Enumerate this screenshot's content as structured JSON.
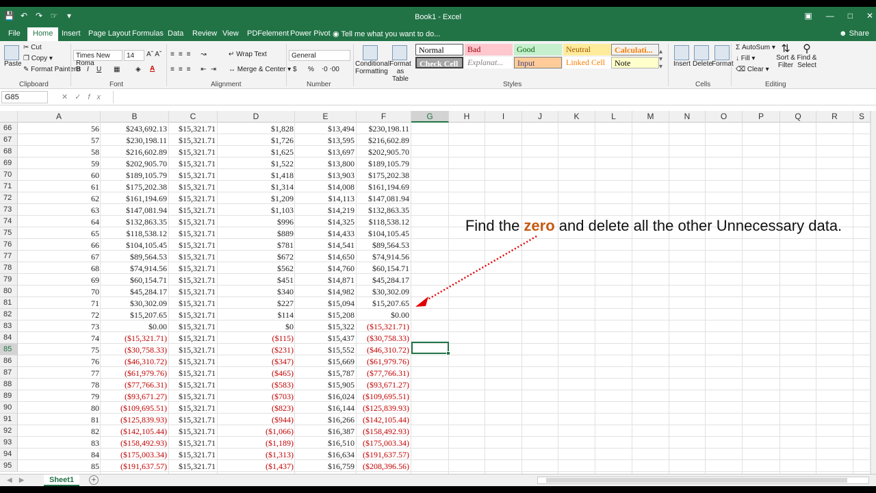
{
  "window": {
    "title": "Book1 - Excel",
    "qat": [
      "save",
      "undo",
      "redo",
      "touch",
      "customize"
    ]
  },
  "tabs": [
    "File",
    "Home",
    "Insert",
    "Page Layout",
    "Formulas",
    "Data",
    "Review",
    "View",
    "PDFelement",
    "Power Pivot"
  ],
  "tell_me": "Tell me what you want to do...",
  "share": "Share",
  "ribbon": {
    "clipboard": {
      "paste": "Paste",
      "cut": "Cut",
      "copy": "Copy",
      "format_painter": "Format Painter",
      "label": "Clipboard"
    },
    "font": {
      "name": "Times New Roma",
      "size": "14",
      "label": "Font",
      "bold": "B",
      "italic": "I",
      "underline": "U"
    },
    "alignment": {
      "wrap": "Wrap Text",
      "merge": "Merge & Center",
      "label": "Alignment"
    },
    "number": {
      "format": "General",
      "currency": "$",
      "percent": "%",
      "label": "Number"
    },
    "styles": {
      "conditional": "Conditional Formatting",
      "format_table": "Format as Table",
      "cells": [
        {
          "text": "Normal",
          "bg": "#ffffff",
          "fg": "#000000"
        },
        {
          "text": "Bad",
          "bg": "#ffc7ce",
          "fg": "#9c0006"
        },
        {
          "text": "Good",
          "bg": "#c6efce",
          "fg": "#006100"
        },
        {
          "text": "Neutral",
          "bg": "#ffeb9c",
          "fg": "#9c5700"
        },
        {
          "text": "Calculati...",
          "bg": "#f2f2f2",
          "fg": "#fa7d00"
        },
        {
          "text": "Check Cell",
          "bg": "#a5a5a5",
          "fg": "#ffffff"
        },
        {
          "text": "Explanat...",
          "bg": "#ffffff",
          "fg": "#7f7f7f"
        },
        {
          "text": "Input",
          "bg": "#ffcc99",
          "fg": "#3f3f76"
        },
        {
          "text": "Linked Cell",
          "bg": "#ffffff",
          "fg": "#fa7d00"
        },
        {
          "text": "Note",
          "bg": "#ffffcc",
          "fg": "#000000"
        }
      ],
      "label": "Styles"
    },
    "cells": {
      "insert": "Insert",
      "delete": "Delete",
      "format": "Format",
      "label": "Cells"
    },
    "editing": {
      "autosum": "AutoSum",
      "fill": "Fill",
      "clear": "Clear",
      "sort": "Sort & Filter",
      "find": "Find & Select",
      "label": "Editing"
    }
  },
  "namebox": "G85",
  "columns": [
    "A",
    "B",
    "C",
    "D",
    "E",
    "F",
    "G",
    "H",
    "I",
    "J",
    "K",
    "L",
    "M",
    "N",
    "O",
    "P",
    "Q",
    "R",
    "S"
  ],
  "selected_column": "G",
  "selected_row": "85",
  "rows": [
    [
      "66",
      "56",
      "$243,692.13",
      "$15,321.71",
      "$1,828",
      "$13,494",
      "$230,198.11"
    ],
    [
      "67",
      "57",
      "$230,198.11",
      "$15,321.71",
      "$1,726",
      "$13,595",
      "$216,602.89"
    ],
    [
      "68",
      "58",
      "$216,602.89",
      "$15,321.71",
      "$1,625",
      "$13,697",
      "$202,905.70"
    ],
    [
      "69",
      "59",
      "$202,905.70",
      "$15,321.71",
      "$1,522",
      "$13,800",
      "$189,105.79"
    ],
    [
      "70",
      "60",
      "$189,105.79",
      "$15,321.71",
      "$1,418",
      "$13,903",
      "$175,202.38"
    ],
    [
      "71",
      "61",
      "$175,202.38",
      "$15,321.71",
      "$1,314",
      "$14,008",
      "$161,194.69"
    ],
    [
      "72",
      "62",
      "$161,194.69",
      "$15,321.71",
      "$1,209",
      "$14,113",
      "$147,081.94"
    ],
    [
      "73",
      "63",
      "$147,081.94",
      "$15,321.71",
      "$1,103",
      "$14,219",
      "$132,863.35"
    ],
    [
      "74",
      "64",
      "$132,863.35",
      "$15,321.71",
      "$996",
      "$14,325",
      "$118,538.12"
    ],
    [
      "75",
      "65",
      "$118,538.12",
      "$15,321.71",
      "$889",
      "$14,433",
      "$104,105.45"
    ],
    [
      "76",
      "66",
      "$104,105.45",
      "$15,321.71",
      "$781",
      "$14,541",
      "$89,564.53"
    ],
    [
      "77",
      "67",
      "$89,564.53",
      "$15,321.71",
      "$672",
      "$14,650",
      "$74,914.56"
    ],
    [
      "78",
      "68",
      "$74,914.56",
      "$15,321.71",
      "$562",
      "$14,760",
      "$60,154.71"
    ],
    [
      "79",
      "69",
      "$60,154.71",
      "$15,321.71",
      "$451",
      "$14,871",
      "$45,284.17"
    ],
    [
      "80",
      "70",
      "$45,284.17",
      "$15,321.71",
      "$340",
      "$14,982",
      "$30,302.09"
    ],
    [
      "81",
      "71",
      "$30,302.09",
      "$15,321.71",
      "$227",
      "$15,094",
      "$15,207.65"
    ],
    [
      "82",
      "72",
      "$15,207.65",
      "$15,321.71",
      "$114",
      "$15,208",
      "$0.00"
    ],
    [
      "83",
      "73",
      "$0.00",
      "$15,321.71",
      "$0",
      "$15,322",
      "($15,321.71)"
    ],
    [
      "84",
      "74",
      "($15,321.71)",
      "$15,321.71",
      "($115)",
      "$15,437",
      "($30,758.33)"
    ],
    [
      "85",
      "75",
      "($30,758.33)",
      "$15,321.71",
      "($231)",
      "$15,552",
      "($46,310.72)"
    ],
    [
      "86",
      "76",
      "($46,310.72)",
      "$15,321.71",
      "($347)",
      "$15,669",
      "($61,979.76)"
    ],
    [
      "87",
      "77",
      "($61,979.76)",
      "$15,321.71",
      "($465)",
      "$15,787",
      "($77,766.31)"
    ],
    [
      "88",
      "78",
      "($77,766.31)",
      "$15,321.71",
      "($583)",
      "$15,905",
      "($93,671.27)"
    ],
    [
      "89",
      "79",
      "($93,671.27)",
      "$15,321.71",
      "($703)",
      "$16,024",
      "($109,695.51)"
    ],
    [
      "90",
      "80",
      "($109,695.51)",
      "$15,321.71",
      "($823)",
      "$16,144",
      "($125,839.93)"
    ],
    [
      "91",
      "81",
      "($125,839.93)",
      "$15,321.71",
      "($944)",
      "$16,266",
      "($142,105.44)"
    ],
    [
      "92",
      "82",
      "($142,105.44)",
      "$15,321.71",
      "($1,066)",
      "$16,387",
      "($158,492.93)"
    ],
    [
      "93",
      "83",
      "($158,492.93)",
      "$15,321.71",
      "($1,189)",
      "$16,510",
      "($175,003.34)"
    ],
    [
      "94",
      "84",
      "($175,003.34)",
      "$15,321.71",
      "($1,313)",
      "$16,634",
      "($191,637.57)"
    ],
    [
      "95",
      "85",
      "($191,637.57)",
      "$15,321.71",
      "($1,437)",
      "$16,759",
      "($208,396.56)"
    ]
  ],
  "annotation": {
    "pre": "Find the ",
    "highlight": "zero",
    "post": " and delete all the other Unnecessary data."
  },
  "sheet_tab": "Sheet1",
  "colors": {
    "excel_green": "#217346",
    "negative": "#c00000",
    "highlight": "#c55a11",
    "arrow": "#e00000"
  }
}
